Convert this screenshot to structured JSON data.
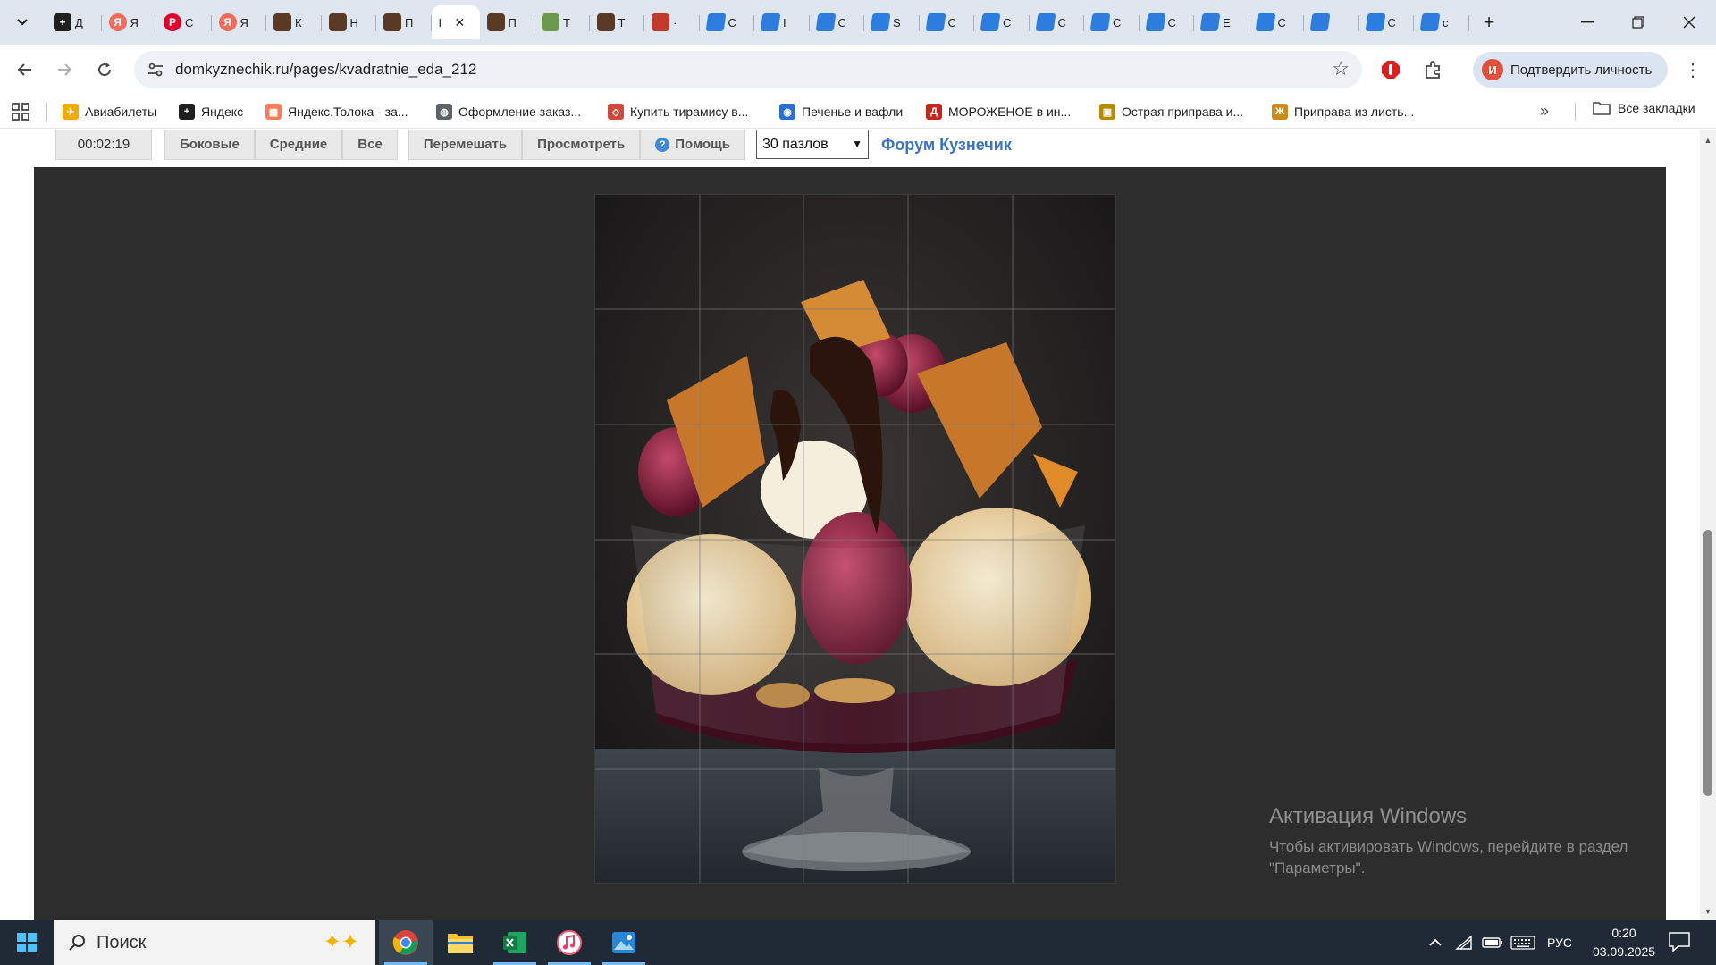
{
  "browser": {
    "tabs": [
      {
        "title": "Д",
        "favicon": "dark-square-icon",
        "color": "#1f1f1f",
        "glyph": "+"
      },
      {
        "title": "Я",
        "favicon": "yandex-icon",
        "color": "#f06b5a",
        "glyph": "Я"
      },
      {
        "title": "С",
        "favicon": "pinterest-icon",
        "color": "#e0002b",
        "glyph": "P"
      },
      {
        "title": "Я",
        "favicon": "yandex-icon",
        "color": "#f06b5a",
        "glyph": "Я"
      },
      {
        "title": "К",
        "favicon": "puzzle-thumb-icon",
        "color": "#5b3a25",
        "glyph": ""
      },
      {
        "title": "Н",
        "favicon": "puzzle-thumb-icon",
        "color": "#5b3a25",
        "glyph": ""
      },
      {
        "title": "П",
        "favicon": "puzzle-thumb-icon",
        "color": "#5b3a25",
        "glyph": ""
      },
      {
        "title": "I",
        "favicon": "active-tab",
        "color": "#ffffff",
        "glyph": "",
        "active": true
      },
      {
        "title": "П",
        "favicon": "puzzle-thumb-icon",
        "color": "#5b3a25",
        "glyph": ""
      },
      {
        "title": "Т",
        "favicon": "landscape-icon",
        "color": "#6a9a4a",
        "glyph": ""
      },
      {
        "title": "Т",
        "favicon": "puzzle-thumb-icon",
        "color": "#5b3a25",
        "glyph": ""
      },
      {
        "title": "·",
        "favicon": "figure-icon",
        "color": "#c0392b",
        "glyph": ""
      },
      {
        "title": "С",
        "favicon": "blue-doc-icon",
        "color": "#2d7de0",
        "glyph": ""
      },
      {
        "title": "I",
        "favicon": "blue-doc-icon",
        "color": "#2d7de0",
        "glyph": ""
      },
      {
        "title": "С",
        "favicon": "blue-doc-icon",
        "color": "#2d7de0",
        "glyph": ""
      },
      {
        "title": "S",
        "favicon": "blue-doc-icon",
        "color": "#2d7de0",
        "glyph": ""
      },
      {
        "title": "С",
        "favicon": "blue-doc-icon",
        "color": "#2d7de0",
        "glyph": ""
      },
      {
        "title": "С",
        "favicon": "blue-doc-icon",
        "color": "#2d7de0",
        "glyph": ""
      },
      {
        "title": "С",
        "favicon": "blue-doc-icon",
        "color": "#2d7de0",
        "glyph": ""
      },
      {
        "title": "С",
        "favicon": "blue-doc-icon",
        "color": "#2d7de0",
        "glyph": ""
      },
      {
        "title": "С",
        "favicon": "blue-doc-icon",
        "color": "#2d7de0",
        "glyph": ""
      },
      {
        "title": "Е",
        "favicon": "blue-doc-icon",
        "color": "#2d7de0",
        "glyph": ""
      },
      {
        "title": "С",
        "favicon": "blue-doc-icon",
        "color": "#2d7de0",
        "glyph": ""
      },
      {
        "title": "",
        "favicon": "blue-doc-icon",
        "color": "#2d7de0",
        "glyph": ""
      },
      {
        "title": "С",
        "favicon": "blue-doc-icon",
        "color": "#2d7de0",
        "glyph": ""
      },
      {
        "title": "с",
        "favicon": "blue-doc-icon",
        "color": "#2d7de0",
        "glyph": ""
      }
    ],
    "url": "domkyznechik.ru/pages/kvadratnie_eda_212",
    "verify_label": "Подтвердить личность",
    "avatar_letter": "И"
  },
  "bookmarks": [
    {
      "label": "Авиабилеты",
      "color": "#f2a900",
      "glyph": "✈"
    },
    {
      "label": "Яндекс",
      "color": "#1f1f1f",
      "glyph": "+"
    },
    {
      "label": "Яндекс.Толока - за...",
      "color": "#ff7a59",
      "glyph": "▦"
    },
    {
      "label": "Оформление заказ...",
      "color": "#5f6368",
      "glyph": "◍"
    },
    {
      "label": "Купить тирамису в...",
      "color": "#d04a3a",
      "glyph": "◇"
    },
    {
      "label": "Печенье и вафли",
      "color": "#2a6fd6",
      "glyph": "◉"
    },
    {
      "label": "МОРОЖЕНОЕ в ин...",
      "color": "#c0281d",
      "glyph": "Д"
    },
    {
      "label": "Острая приправа и...",
      "color": "#b88a00",
      "glyph": "▣"
    },
    {
      "label": "Приправа из листь...",
      "color": "#c98a1c",
      "glyph": "Ж"
    }
  ],
  "bookmarks_all": "Все закладки",
  "game": {
    "timer": "00:02:19",
    "buttons": [
      "Боковые",
      "Средние",
      "Все"
    ],
    "actions": [
      "Перемешать",
      "Просмотреть"
    ],
    "help": "Помощь",
    "pieces_select": "30 пазлов",
    "forum": "Форум Кузнечик"
  },
  "watermark": {
    "title": "Активация Windows",
    "text": "Чтобы активировать Windows, перейдите в раздел \"Параметры\"."
  },
  "taskbar": {
    "search_placeholder": "Поиск",
    "lang": "РУС",
    "time": "0:20",
    "date": "03.09.2025"
  },
  "colors": {
    "board": "#2d2d2d",
    "accent": "#3a73c8",
    "taskbar": "#1f2a36"
  }
}
